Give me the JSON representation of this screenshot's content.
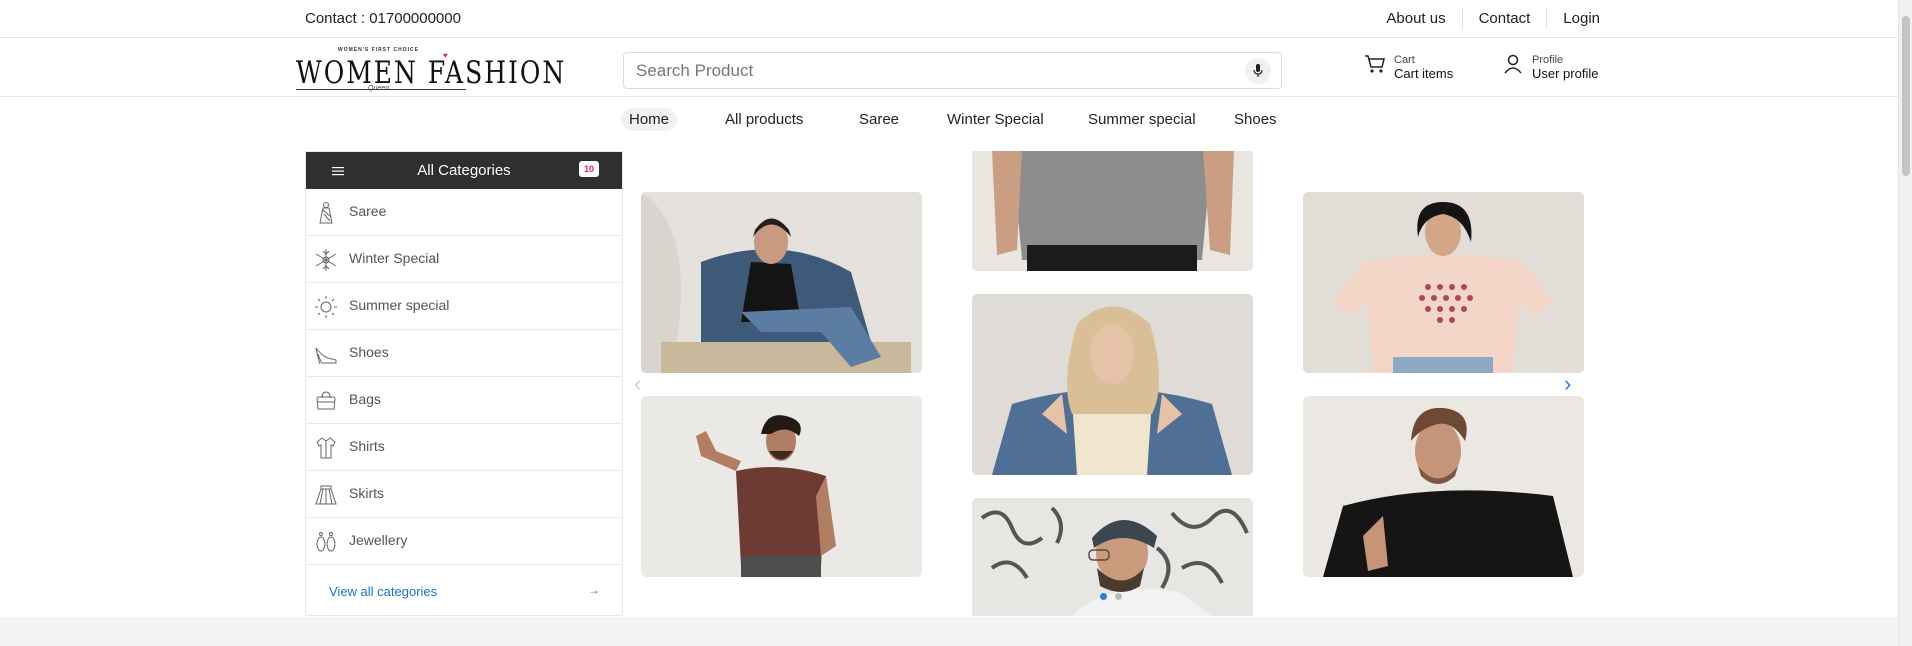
{
  "topbar": {
    "contact": "Contact : 01700000000",
    "links": [
      "About us",
      "Contact",
      "Login"
    ]
  },
  "logo": {
    "tagline": "WOMEN'S FIRST CHOICE",
    "word": "WOMEN FASHION",
    "signature": "Queen"
  },
  "search": {
    "placeholder": "Search Product",
    "value": ""
  },
  "header": {
    "cart_small": "Cart",
    "cart_big": "Cart items",
    "profile_small": "Profile",
    "profile_big": "User profile"
  },
  "nav": {
    "items": [
      "Home",
      "All products",
      "Saree",
      "Winter Special",
      "Summer special",
      "Shoes"
    ],
    "active": "Home"
  },
  "sidebar": {
    "title": "All Categories",
    "count": "10",
    "items": [
      {
        "label": "Saree",
        "icon": "saree-icon"
      },
      {
        "label": "Winter Special",
        "icon": "snowflake-icon"
      },
      {
        "label": "Summer special",
        "icon": "sun-icon"
      },
      {
        "label": "Shoes",
        "icon": "high-heel-icon"
      },
      {
        "label": "Bags",
        "icon": "bag-icon"
      },
      {
        "label": "Shirts",
        "icon": "shirt-icon"
      },
      {
        "label": "Skirts",
        "icon": "skirt-icon"
      },
      {
        "label": "Jewellery",
        "icon": "earrings-icon"
      }
    ],
    "view_all": "View all categories"
  },
  "gallery": {
    "photos": [
      {
        "name": "woman-denim-jacket-sitting"
      },
      {
        "name": "man-grey-tshirt"
      },
      {
        "name": "woman-peach-tshirt"
      },
      {
        "name": "man-maroon-tshirt"
      },
      {
        "name": "woman-blonde-denim-jacket"
      },
      {
        "name": "man-black-tshirt"
      },
      {
        "name": "man-beanie-glasses"
      }
    ],
    "active_dot": 0,
    "dot_count": 2
  },
  "colors": {
    "accent": "#2a7de1",
    "badge": "#e91e63",
    "dark": "#2f2f2f"
  }
}
